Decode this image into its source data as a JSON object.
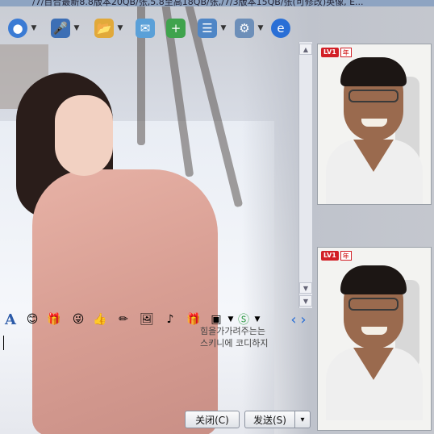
{
  "window": {
    "title": "/7/百合最新8.8版本20QB/张,5.8至高18QB/张,/7/3版本15QB/张(可修改)英像, E..."
  },
  "toolbar": {
    "items": [
      {
        "name": "video-call",
        "icon": "webcam-icon",
        "color": "#3b7bd4"
      },
      {
        "name": "voice-call",
        "icon": "microphone-icon",
        "color": "#3d6fb5"
      },
      {
        "name": "send-file",
        "icon": "folder-icon",
        "color": "#e1a93a"
      },
      {
        "name": "send-sms",
        "icon": "envelope-icon",
        "color": "#5aa0d8"
      },
      {
        "name": "create-group",
        "icon": "add-group-icon",
        "color": "#3fa34d"
      },
      {
        "name": "app-center",
        "icon": "tray-icon",
        "color": "#4f86c6"
      },
      {
        "name": "settings",
        "icon": "gear-icon",
        "color": "#6d8fb9"
      },
      {
        "name": "browser",
        "icon": "globe-icon",
        "color": "#2a6fd6"
      }
    ]
  },
  "video": {
    "badge_level": "LV1",
    "badge_year": "年"
  },
  "format_bar": {
    "font_button": "A",
    "prev": "‹",
    "next": "›"
  },
  "hint_text": {
    "line1": "힘을가가려주는는",
    "line2": "스키니에 코디하지"
  },
  "buttons": {
    "close": "关闭(C)",
    "send": "发送(S)",
    "send_menu": "▾"
  },
  "colors": {
    "accent": "#3b7bd4",
    "badge_red": "#d21f26"
  }
}
